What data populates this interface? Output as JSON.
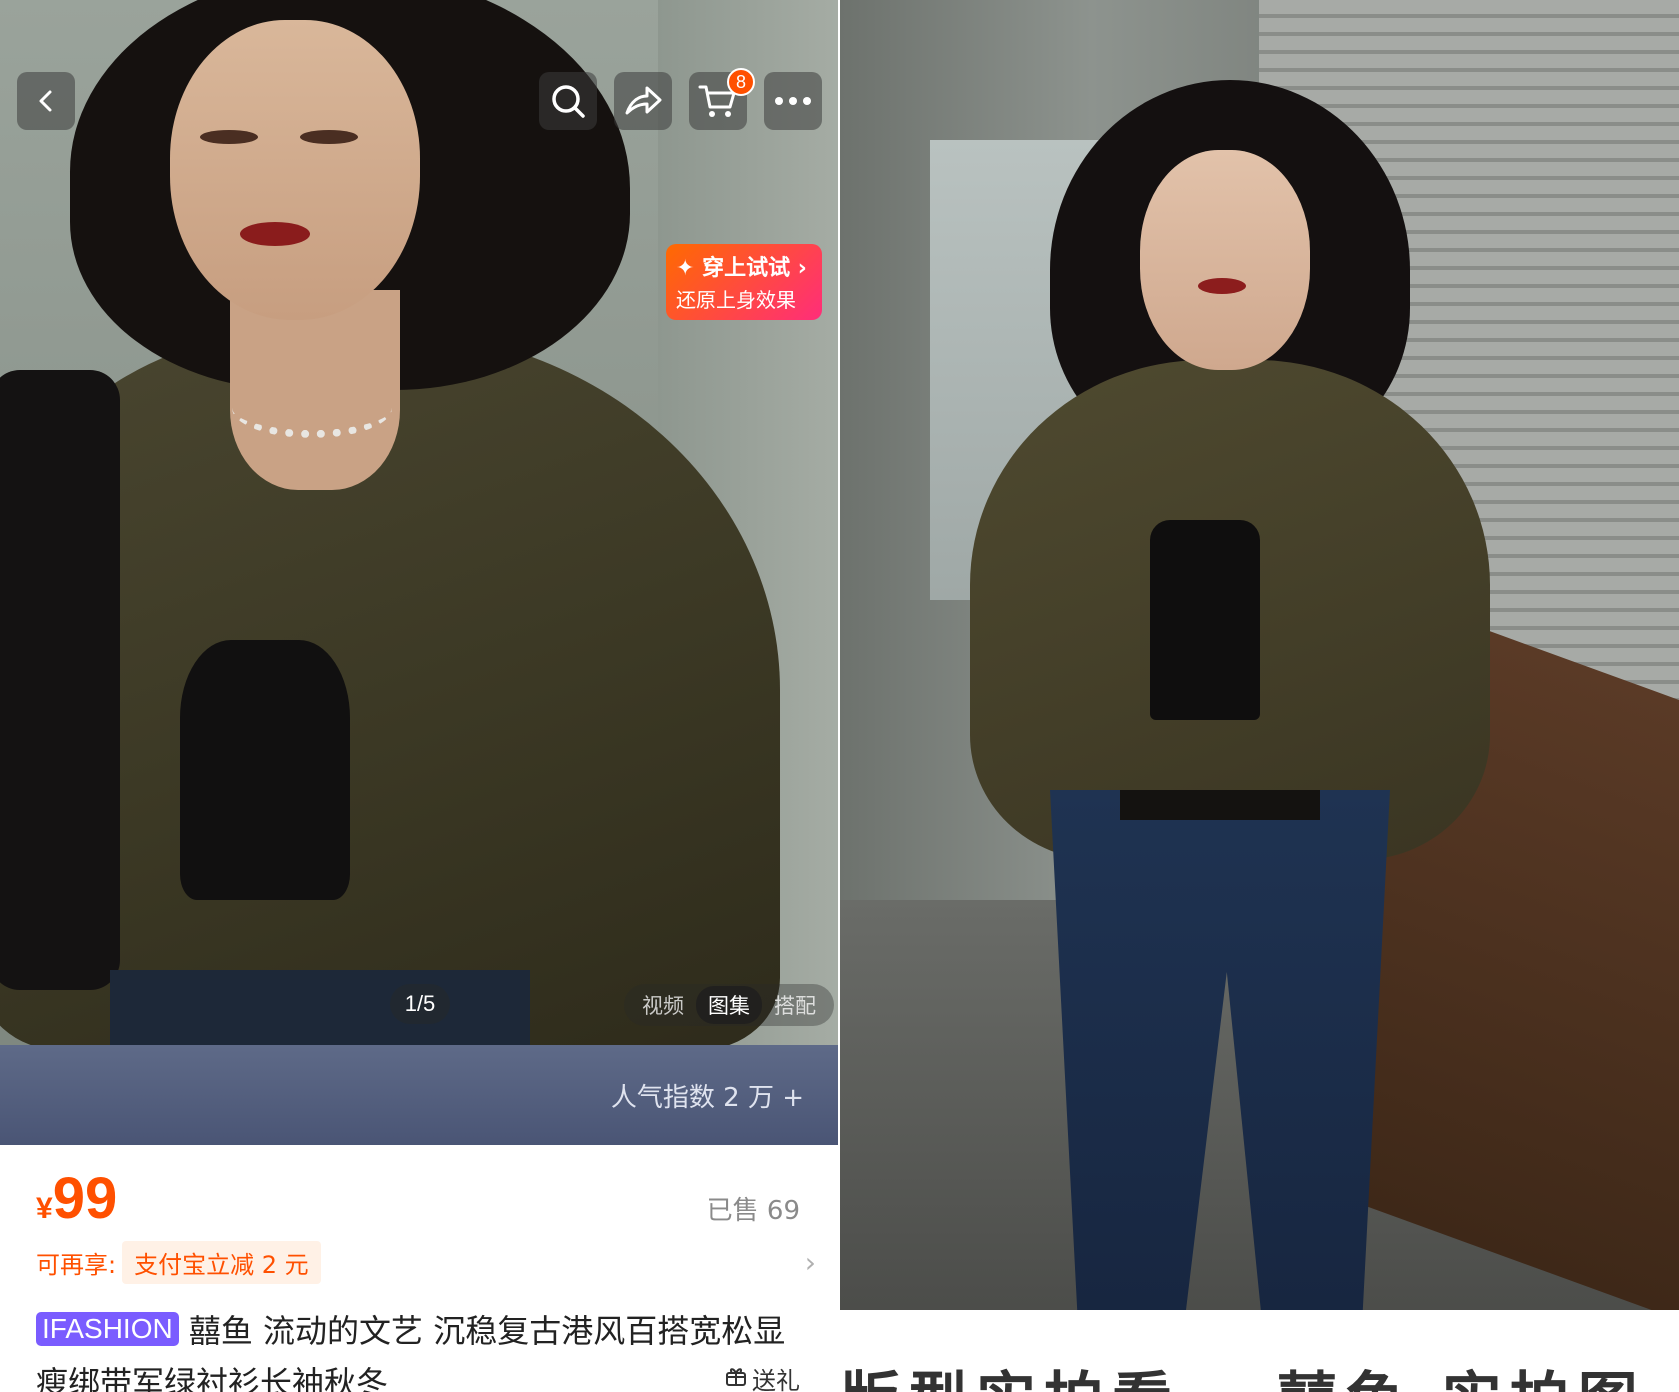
{
  "left": {
    "toolbar": {
      "back_icon": "chevron-left-icon",
      "search_icon": "search-icon",
      "share_icon": "share-icon",
      "cart_icon": "cart-icon",
      "cart_badge": "8",
      "more_icon": "more-icon"
    },
    "tryon": {
      "title": "✦ 穿上试试 ›",
      "subtitle": "还原上身效果"
    },
    "pager": "1/5",
    "media_tabs": [
      {
        "label": "视频",
        "active": false
      },
      {
        "label": "图集",
        "active": true
      },
      {
        "label": "搭配",
        "active": false
      }
    ],
    "popularity": "人气指数 2 万 +",
    "price": {
      "currency": "¥",
      "value": "99"
    },
    "sold": "已售 69",
    "promo": {
      "label": "可再享:",
      "chip": "支付宝立减 2 元",
      "arrow": "›"
    },
    "title": {
      "brand_tag": "IFASHION",
      "text": "囍鱼 流动的文艺 沉稳复古港风百搭宽松显瘦绑带军绿衬衫长袖秋冬"
    },
    "gift": {
      "icon": "gift-icon",
      "label": "送礼"
    }
  },
  "right": {
    "bottom_text": "版型实拍看… 囍鱼 实拍图"
  },
  "colors": {
    "accent": "#ff5000",
    "brand_tag": "#7a5cff",
    "tryon_start": "#ff6a00",
    "tryon_end": "#ff2d7a"
  }
}
